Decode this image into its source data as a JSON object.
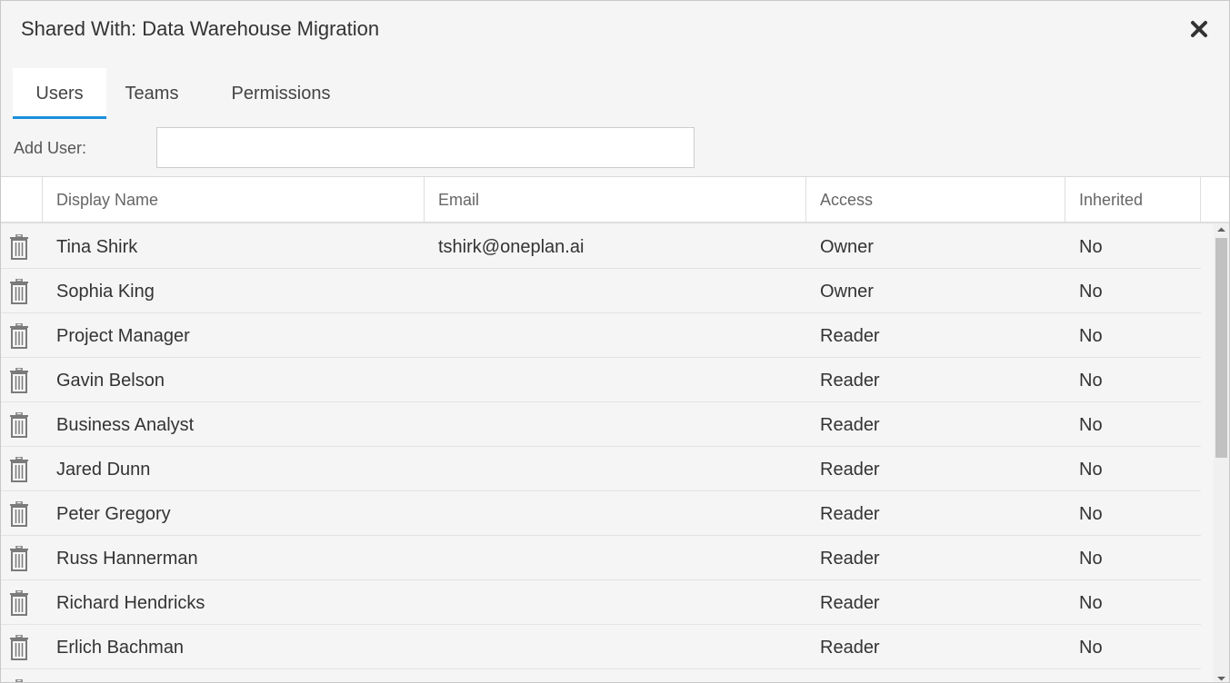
{
  "dialog": {
    "title": "Shared With: Data Warehouse Migration",
    "close_icon": "close-icon"
  },
  "tabs": [
    {
      "label": "Users",
      "active": true
    },
    {
      "label": "Teams",
      "active": false
    },
    {
      "label": "Permissions",
      "active": false
    }
  ],
  "add_user": {
    "label": "Add User:",
    "value": "",
    "placeholder": ""
  },
  "table": {
    "columns": [
      "Display Name",
      "Email",
      "Access",
      "Inherited"
    ],
    "rows": [
      {
        "name": "Tina Shirk",
        "email": "tshirk@oneplan.ai",
        "access": "Owner",
        "inherited": "No"
      },
      {
        "name": "Sophia King",
        "email": "",
        "access": "Owner",
        "inherited": "No"
      },
      {
        "name": "Project Manager",
        "email": "",
        "access": "Reader",
        "inherited": "No"
      },
      {
        "name": "Gavin Belson",
        "email": "",
        "access": "Reader",
        "inherited": "No"
      },
      {
        "name": "Business Analyst",
        "email": "",
        "access": "Reader",
        "inherited": "No"
      },
      {
        "name": "Jared Dunn",
        "email": "",
        "access": "Reader",
        "inherited": "No"
      },
      {
        "name": "Peter Gregory",
        "email": "",
        "access": "Reader",
        "inherited": "No"
      },
      {
        "name": "Russ Hannerman",
        "email": "",
        "access": "Reader",
        "inherited": "No"
      },
      {
        "name": "Richard Hendricks",
        "email": "",
        "access": "Reader",
        "inherited": "No"
      },
      {
        "name": "Erlich Bachman",
        "email": "",
        "access": "Reader",
        "inherited": "No"
      }
    ],
    "row_icon": "trash-icon"
  },
  "colors": {
    "accent": "#1b8fd8",
    "dialog_bg": "#f5f5f5",
    "text": "#333333"
  }
}
